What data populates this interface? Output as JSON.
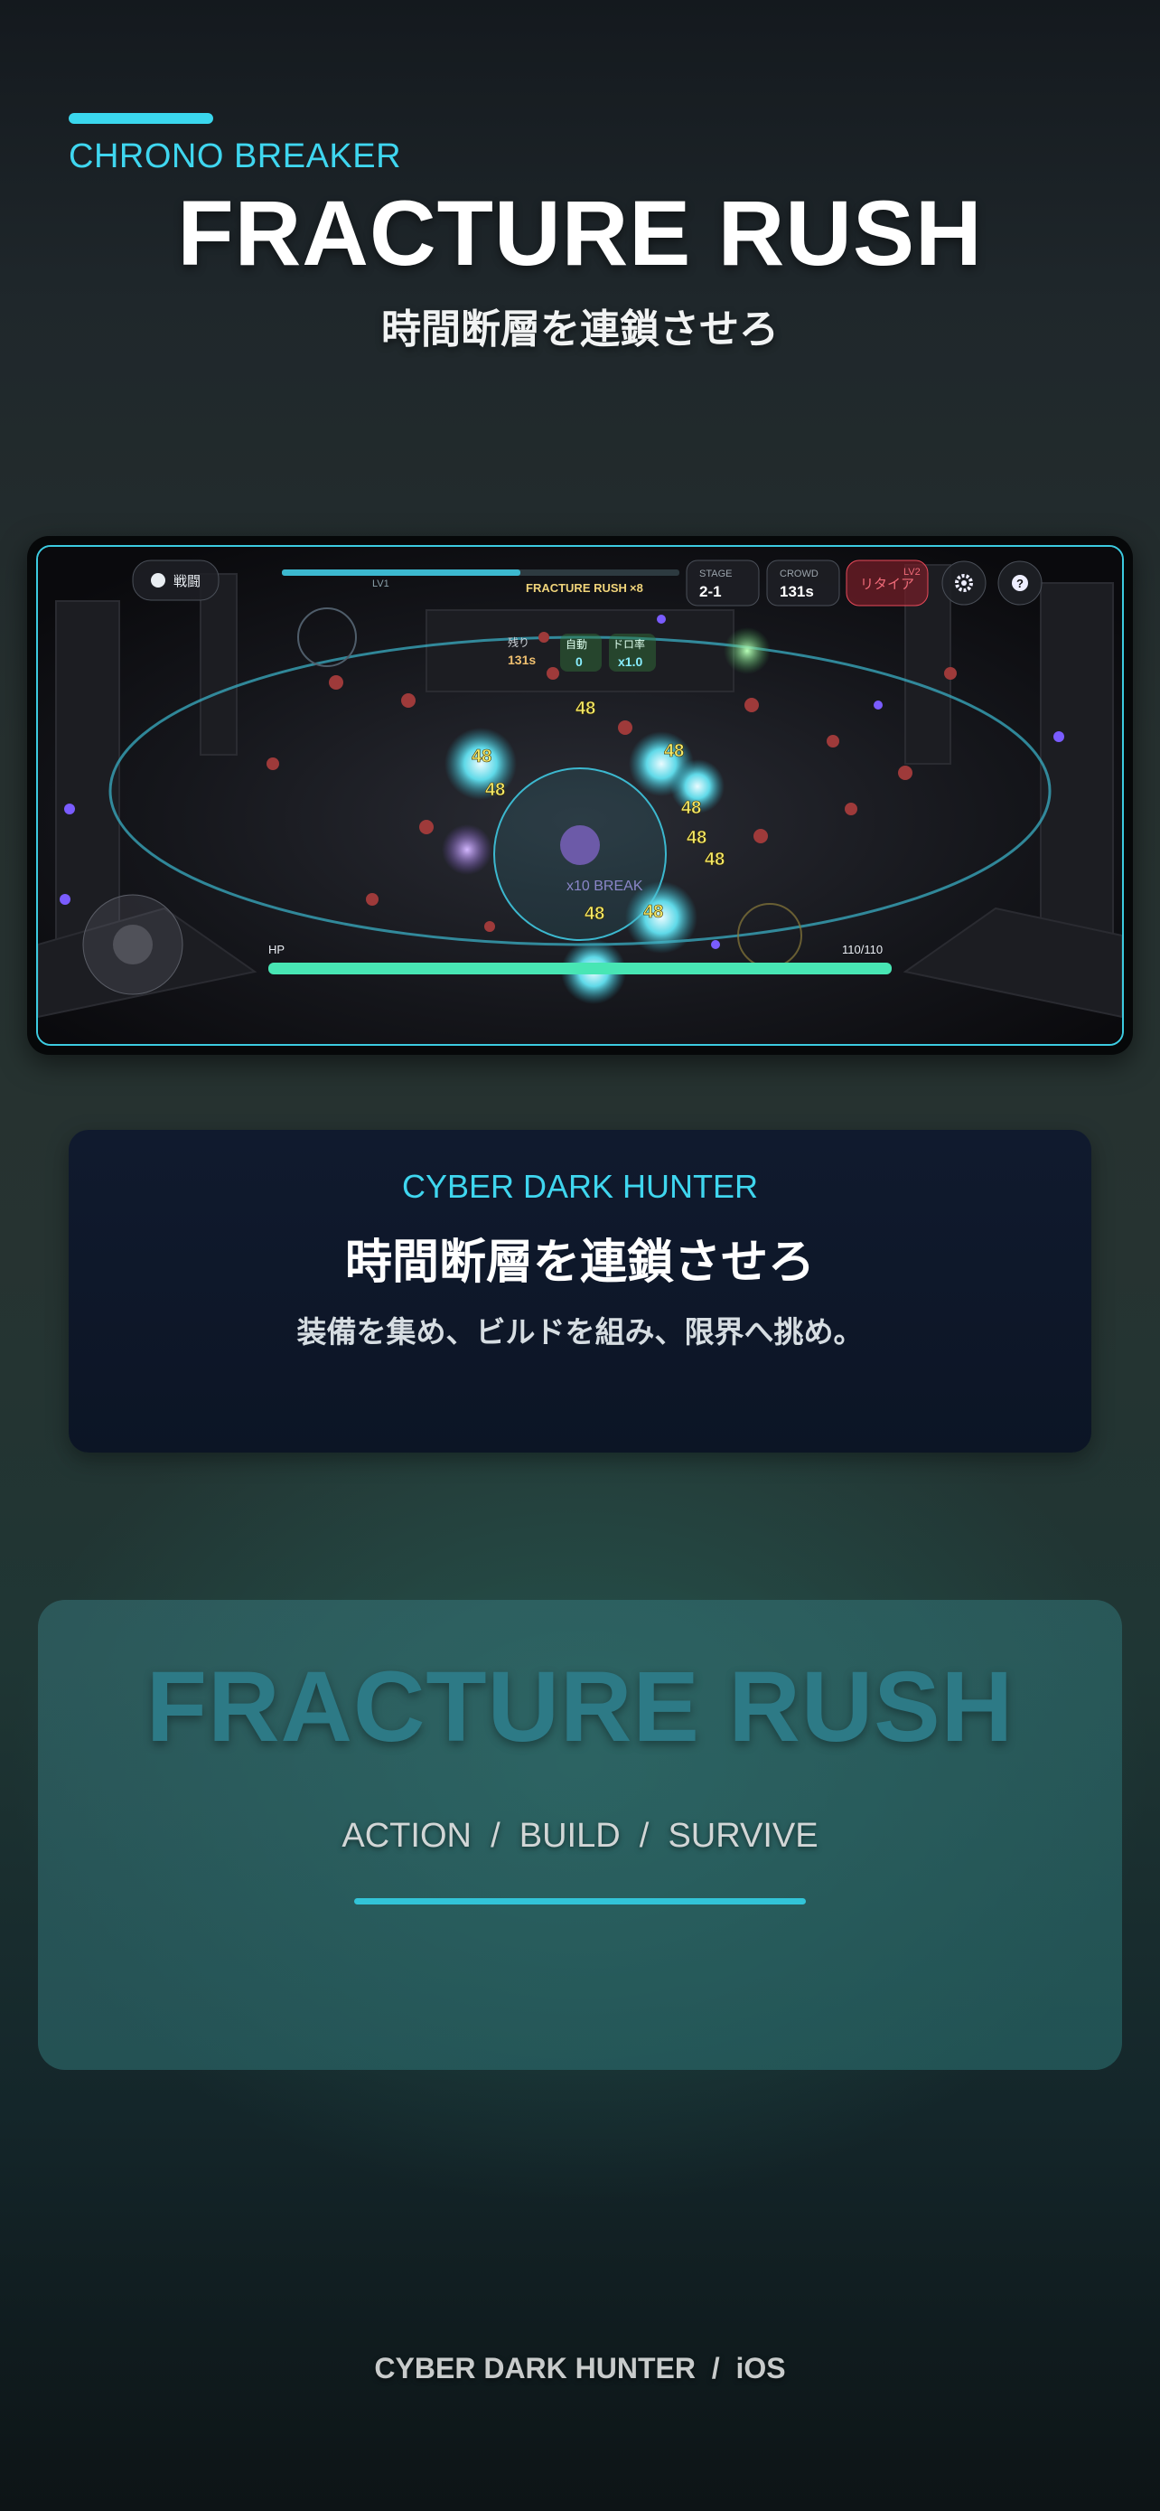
{
  "header": {
    "brand": "CHRONO BREAKER",
    "title": "FRACTURE RUSH",
    "subtitle": "時間断層を連鎖させろ"
  },
  "gameplay": {
    "mode_label": "戦闘",
    "banner_text": "FRACTURE RUSH",
    "combo": "×8",
    "level_tag": "LV1",
    "stage_label": "STAGE",
    "stage_value": "2-1",
    "crowd_label": "CROWD",
    "crowd_value": "131s",
    "retire_label": "リタイア",
    "retire_level": "LV2",
    "remaining_label": "残り",
    "remaining_value": "131s",
    "auto_label": "自動",
    "auto_value": "0",
    "drop_label": "ドロ率",
    "drop_value": "x1.0",
    "damage_number": "48",
    "break_text": "x10 BREAK",
    "hp_label": "HP",
    "hp_value": "110/110",
    "hp_fraction": 1.0,
    "xp_fraction": 0.6
  },
  "info_card": {
    "tag": "CYBER DARK HUNTER",
    "headline": "時間断層を連鎖させろ",
    "tagline": "装備を集め、ビルドを組み、限界へ挑め。"
  },
  "promo": {
    "title": "FRACTURE RUSH",
    "tags": "ACTION  /  BUILD  /  SURVIVE"
  },
  "footer": {
    "text": "CYBER DARK HUNTER  /  iOS"
  },
  "colors": {
    "accent": "#3ad7ee",
    "hp_bar": "#48e6b4",
    "retire_red": "#e84a5a"
  },
  "icons": [
    "shield-icon",
    "gear-icon",
    "help-icon",
    "joystick-icon"
  ]
}
